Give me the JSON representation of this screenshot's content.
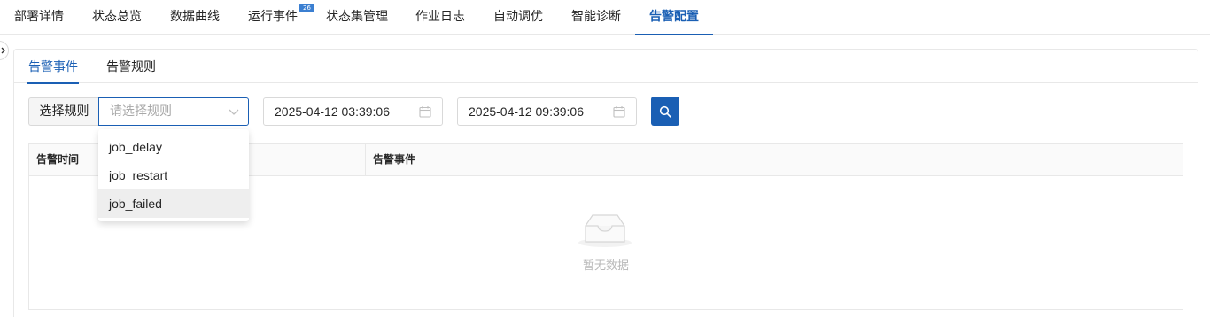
{
  "top_tabs": [
    {
      "label": "部署详情"
    },
    {
      "label": "状态总览"
    },
    {
      "label": "数据曲线"
    },
    {
      "label": "运行事件",
      "badge": "26"
    },
    {
      "label": "状态集管理"
    },
    {
      "label": "作业日志"
    },
    {
      "label": "自动调优"
    },
    {
      "label": "智能诊断"
    },
    {
      "label": "告警配置",
      "active": true
    }
  ],
  "sub_tabs": [
    {
      "label": "告警事件",
      "active": true
    },
    {
      "label": "告警规则"
    }
  ],
  "filter": {
    "rule_label": "选择规则",
    "rule_placeholder": "请选择规则",
    "start_time": "2025-04-12 03:39:06",
    "end_time": "2025-04-12 09:39:06"
  },
  "dropdown_options": [
    "job_delay",
    "job_restart",
    "job_failed"
  ],
  "dropdown_hovered": "job_failed",
  "table": {
    "columns": [
      "告警时间",
      "告警事件"
    ],
    "rows": [],
    "empty_text": "暂无数据"
  },
  "colors": {
    "accent": "#1a5fb4",
    "badge": "#3b7fd1"
  },
  "icons": [
    "chevron-right-icon",
    "chevron-down-icon",
    "calendar-icon",
    "search-icon",
    "empty-inbox-icon"
  ]
}
